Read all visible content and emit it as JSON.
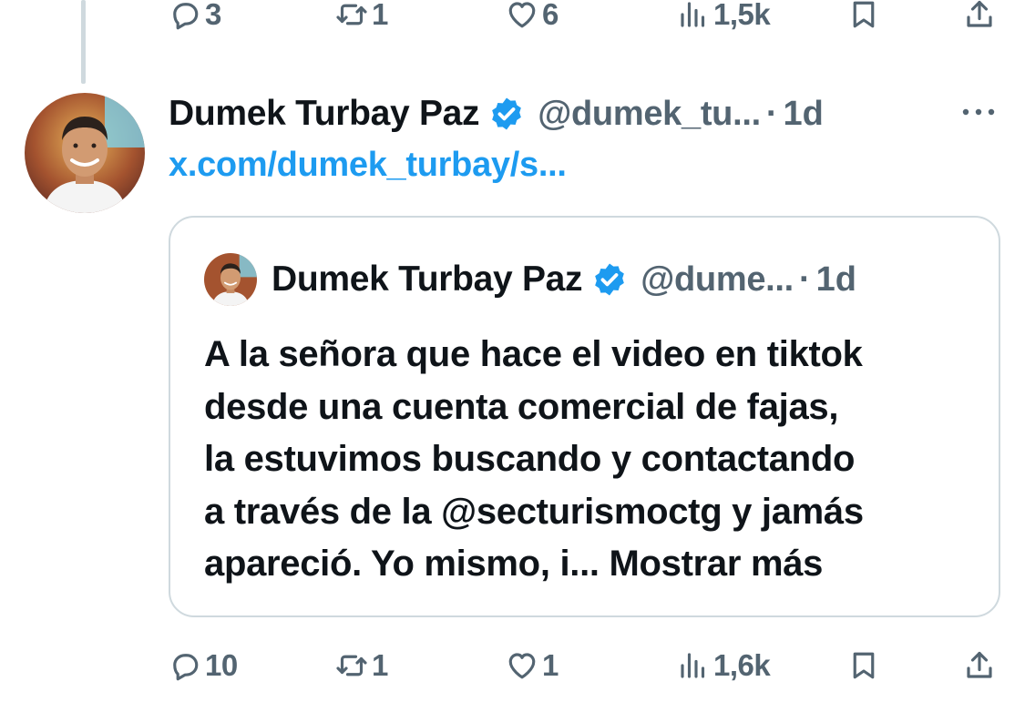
{
  "top_actions": {
    "replies": "3",
    "reposts": "1",
    "likes": "6",
    "views": "1,5k"
  },
  "tweet": {
    "author_name": "Dumek Turbay Paz",
    "handle": "@dumek_tu...",
    "separator": "·",
    "time": "1d",
    "link_text": "x.com/dumek_turbay/s..."
  },
  "quoted": {
    "author_name": "Dumek Turbay Paz",
    "handle": "@dume...",
    "separator": "·",
    "time": "1d",
    "lines": [
      "A la señora que hace el video en tiktok",
      "desde una cuenta comercial de fajas,",
      "la estuvimos buscando y contactando",
      "a través de la @secturismoctg y jamás"
    ],
    "last_line": "apareció. Yo mismo, i...",
    "show_more": "Mostrar más"
  },
  "bottom_actions": {
    "replies": "10",
    "reposts": "1",
    "likes": "1",
    "views": "1,6k"
  },
  "colors": {
    "accent": "#1d9bf0",
    "secondary_text": "#536471",
    "border": "#cfd9de"
  },
  "icons": [
    "reply-icon",
    "repost-icon",
    "like-icon",
    "views-icon",
    "bookmark-icon",
    "share-icon",
    "verified-badge-icon",
    "more-options-icon"
  ]
}
